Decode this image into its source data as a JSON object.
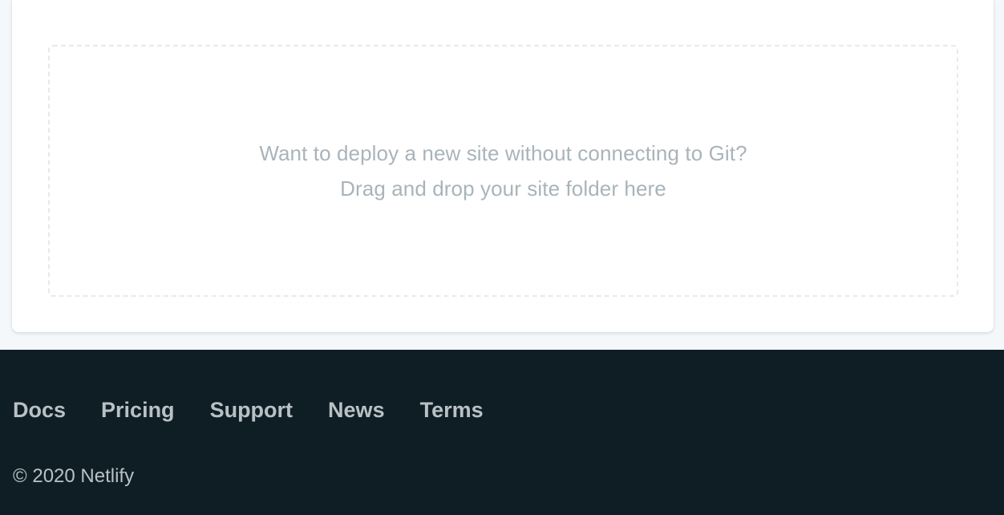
{
  "dropzone": {
    "line1": "Want to deploy a new site without connecting to Git?",
    "line2": "Drag and drop your site folder here"
  },
  "footer": {
    "links": [
      {
        "label": "Docs"
      },
      {
        "label": "Pricing"
      },
      {
        "label": "Support"
      },
      {
        "label": "News"
      },
      {
        "label": "Terms"
      }
    ],
    "copyright": "© 2020 Netlify"
  },
  "colors": {
    "footer_bg": "#0f1e25",
    "footer_text": "#b9c1c5",
    "dropzone_text": "#a9b4ba",
    "dropzone_border": "#e6eaed",
    "page_bg": "#f5f8fa",
    "card_bg": "#ffffff"
  }
}
